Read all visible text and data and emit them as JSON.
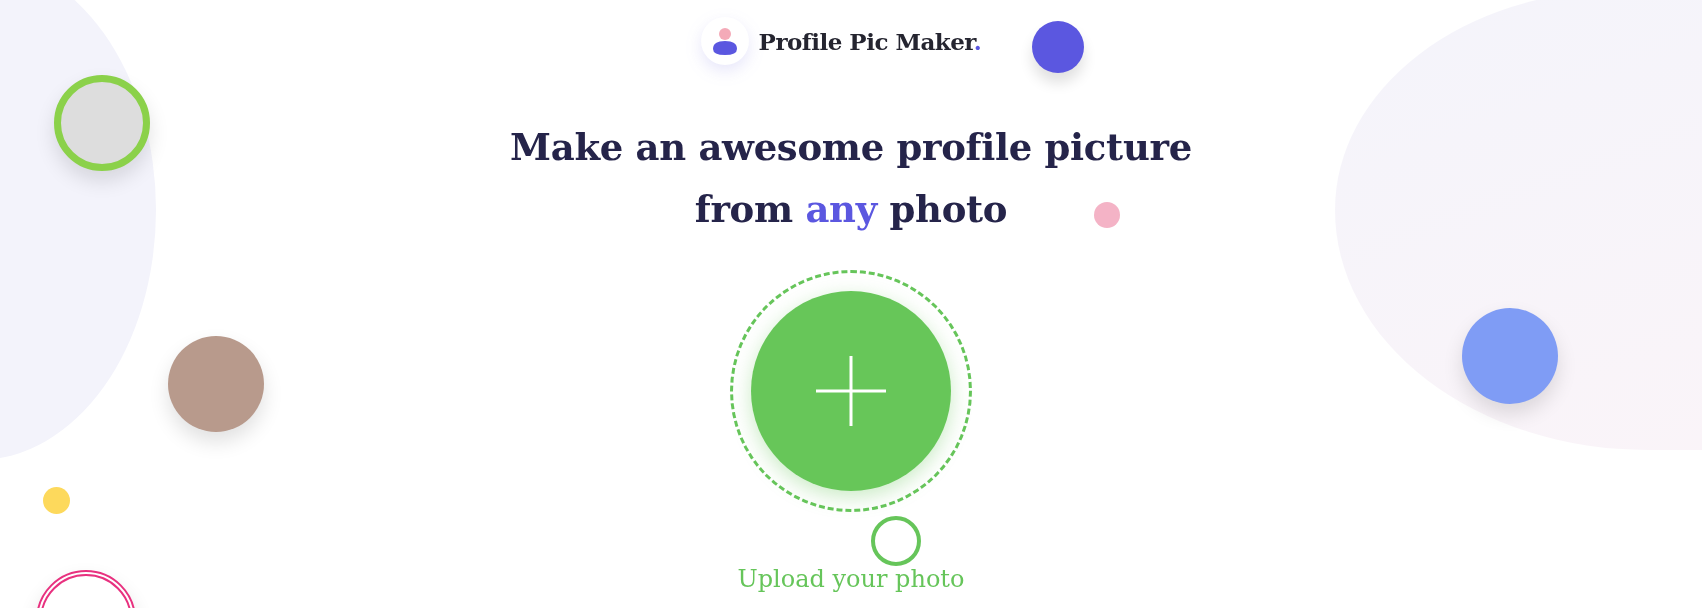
{
  "brand": {
    "name": "Profile Pic Maker",
    "accent": "."
  },
  "headline": {
    "line1": "Make an awesome profile picture",
    "line2_before": "from ",
    "highlight": "any",
    "line2_after": " photo"
  },
  "upload": {
    "label": "Upload your photo"
  }
}
